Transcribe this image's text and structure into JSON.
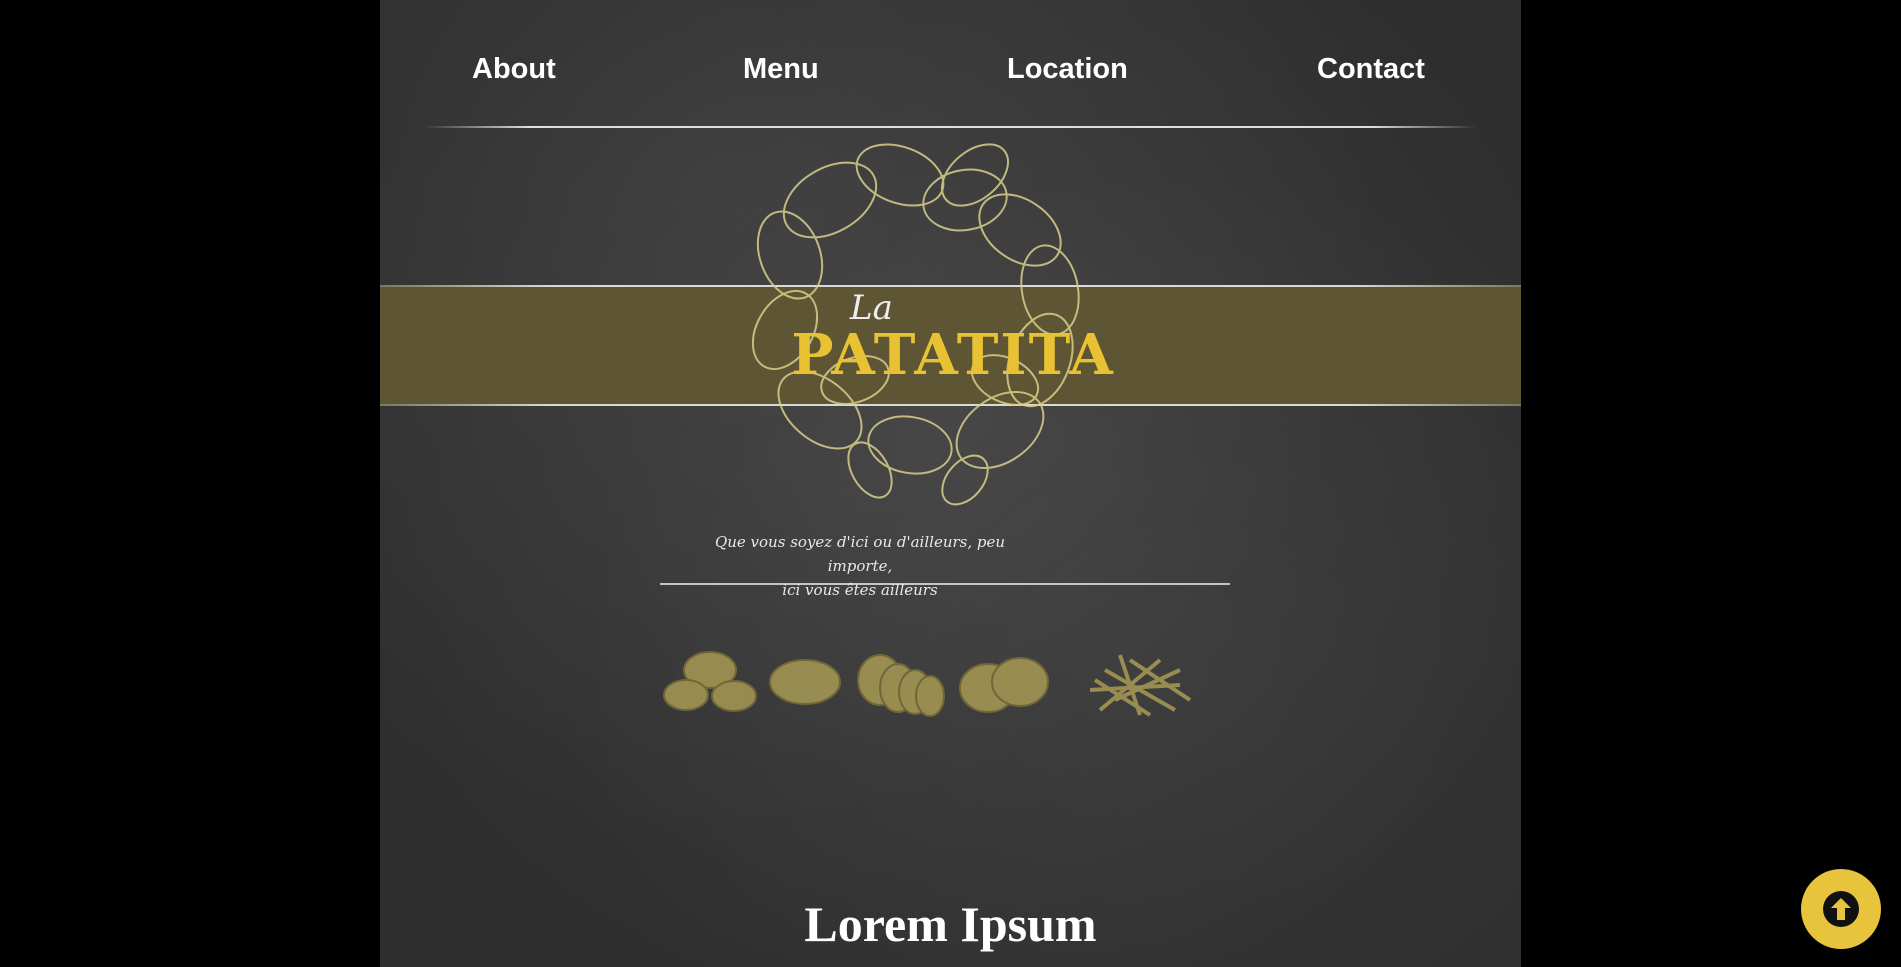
{
  "nav": {
    "items": [
      {
        "label": "About"
      },
      {
        "label": "Menu"
      },
      {
        "label": "Location"
      },
      {
        "label": "Contact"
      }
    ]
  },
  "logo": {
    "article": "La",
    "name": "PATATITA",
    "tagline_line1": "Que vous soyez d'ici ou d'ailleurs, peu importe,",
    "tagline_line2": "ici vous êtes ailleurs"
  },
  "section": {
    "heading": "Lorem Ipsum"
  },
  "icons": [
    "potatoes-pile-icon",
    "potato-icon",
    "sliced-potato-icon",
    "potato-slices-icon",
    "fries-icon",
    "scroll-to-top-icon"
  ],
  "colors": {
    "accent": "#e8c33c",
    "band": "#5e5535",
    "board": "#363636",
    "background": "#000000"
  }
}
